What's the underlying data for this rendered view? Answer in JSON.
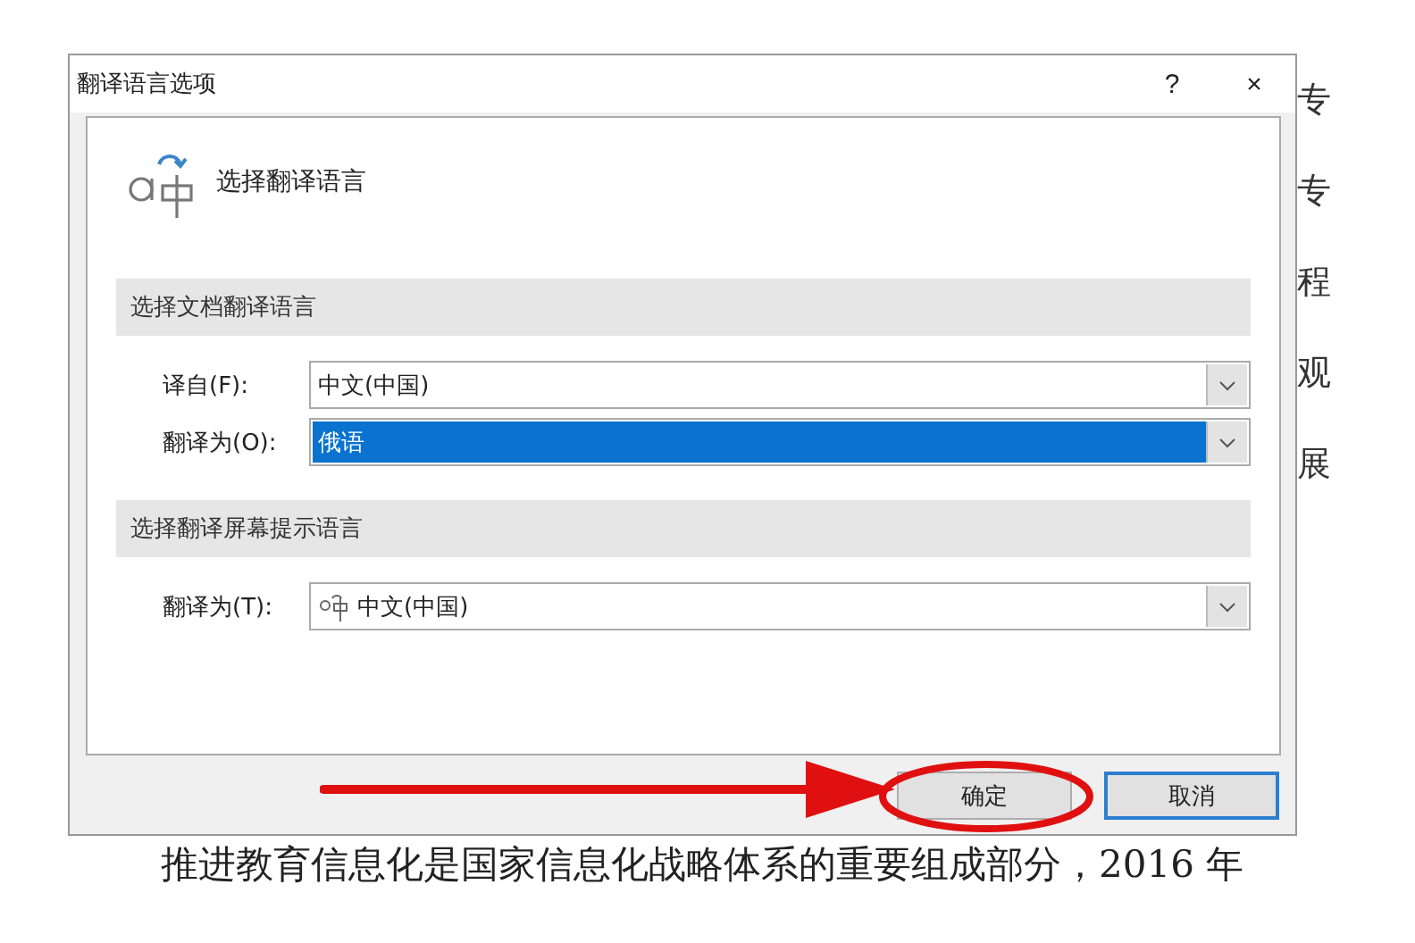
{
  "dialog": {
    "title": "翻译语言选项",
    "help": "?",
    "close": "×",
    "heading": "选择翻译语言",
    "sections": [
      {
        "title": "选择文档翻译语言",
        "rows": [
          {
            "label": "译自(F):",
            "value": "中文(中国)",
            "kind": "plain",
            "selected": false
          },
          {
            "label": "翻译为(O):",
            "value": "俄语",
            "kind": "plain",
            "selected": true
          }
        ]
      },
      {
        "title": "选择翻译屏幕提示语言",
        "rows": [
          {
            "label": "翻译为(T):",
            "value": "中文(中国)",
            "kind": "icon",
            "selected": false
          }
        ]
      }
    ],
    "buttons": [
      {
        "label": "确定",
        "highlighted": false
      },
      {
        "label": "取消",
        "highlighted": true
      }
    ]
  },
  "document": {
    "side_chars": [
      "专",
      "专",
      "程",
      "观",
      "展"
    ],
    "paragraph": "推进教育信息化是国家信息化战略体系的重要组成部分，2016 年"
  }
}
